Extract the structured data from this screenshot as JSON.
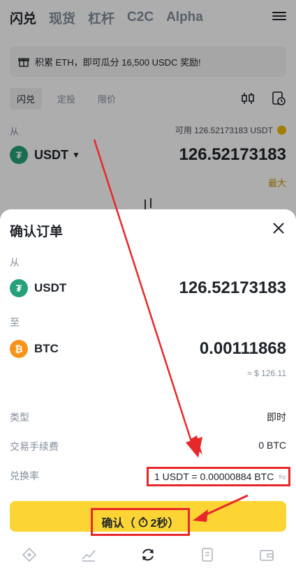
{
  "topnav": {
    "tabs": [
      {
        "label": "闪兑",
        "active": true
      },
      {
        "label": "现货",
        "active": false
      },
      {
        "label": "杠杆",
        "active": false
      },
      {
        "label": "C2C",
        "active": false
      },
      {
        "label": "Alpha",
        "active": false
      }
    ],
    "menu_icon": "hamburger-menu-icon"
  },
  "promo": {
    "text": "积累 ETH，即可瓜分 16,500 USDC 奖励!",
    "icon": "gift-icon"
  },
  "subtabs": [
    {
      "label": "闪兑",
      "active": true
    },
    {
      "label": "定投",
      "active": false
    },
    {
      "label": "限价",
      "active": false
    }
  ],
  "subtools": [
    "candlestick-chart-icon",
    "order-history-icon"
  ],
  "from": {
    "label": "从",
    "available": "可用 126.52173183 USDT",
    "coin": "USDT",
    "amount": "126.52173183",
    "max_label": "最大"
  },
  "modal": {
    "title": "确认订单",
    "from_label": "从",
    "from_coin": "USDT",
    "from_amount": "126.52173183",
    "to_label": "至",
    "to_coin": "BTC",
    "to_amount": "0.00111868",
    "approx_value": "≈ $ 126.11",
    "rows": [
      {
        "key": "类型",
        "value": "即时"
      },
      {
        "key": "交易手续费",
        "value": "0 BTC"
      },
      {
        "key": "兑换率",
        "value": "1 USDT = 0.00000884 BTC"
      }
    ],
    "confirm_label": "确认（",
    "countdown": "2秒）"
  },
  "bottomnav": [
    "home-icon",
    "markets-icon",
    "trade-icon",
    "futures-icon",
    "wallet-icon"
  ],
  "colors": {
    "accent": "#fcd535",
    "annotation": "#e8272a",
    "usdt": "#26a17b",
    "btc": "#f7931a"
  }
}
